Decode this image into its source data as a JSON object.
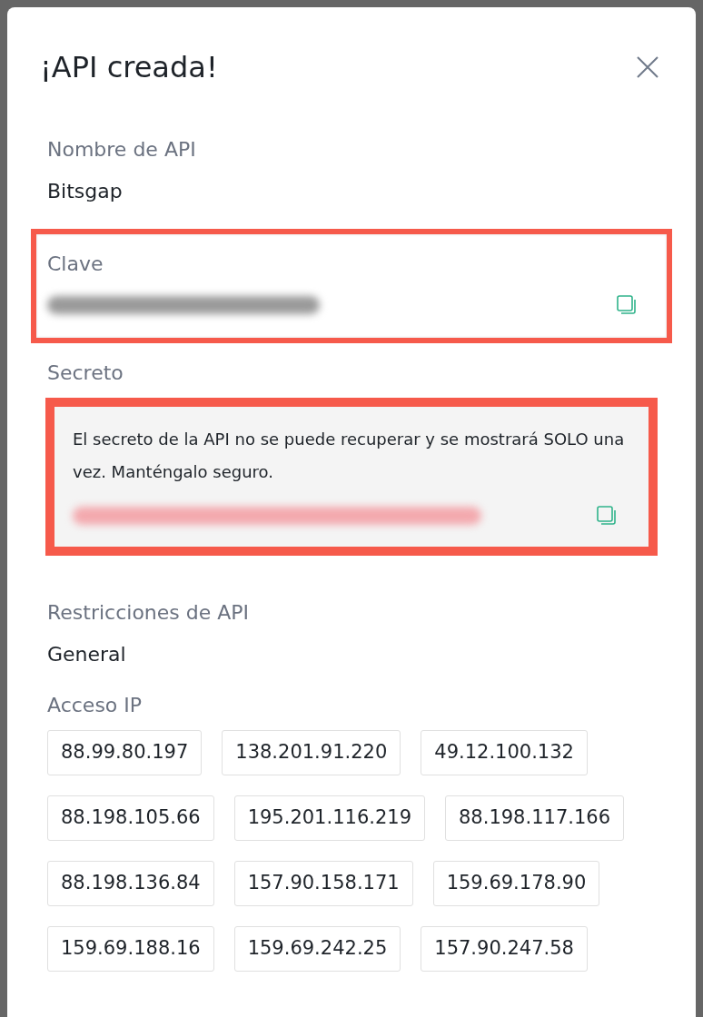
{
  "dialog": {
    "title": "¡API creada!"
  },
  "fields": [
    {
      "kind": "plain",
      "label": "Nombre de API",
      "value": "Bitsgap"
    },
    {
      "kind": "key",
      "label": "Clave",
      "highlighted": true
    },
    {
      "kind": "secret",
      "label": "Secreto",
      "highlighted": true,
      "notice": "El secreto de la API no se puede recuperar y se mostrará SOLO una vez. Manténgalo seguro."
    },
    {
      "kind": "plain",
      "label": "Restricciones de API",
      "value": "General"
    }
  ],
  "ip_access": {
    "label": "Acceso IP",
    "rows": [
      [
        "88.99.80.197",
        "138.201.91.220",
        "49.12.100.132"
      ],
      [
        "88.198.105.66",
        "195.201.116.219",
        "88.198.117.166"
      ],
      [
        "88.198.136.84",
        "157.90.158.171",
        "159.69.178.90"
      ],
      [
        "159.69.188.16",
        "159.69.242.25",
        "157.90.247.58"
      ]
    ]
  }
}
